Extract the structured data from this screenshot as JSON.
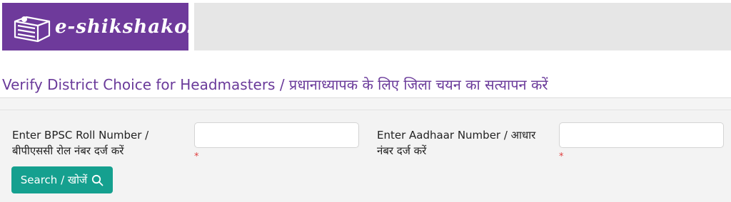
{
  "brand": {
    "logo_text": "e-shikshakosh",
    "logo_icon": "book-stack-icon",
    "logo_color": "#6e3a9b"
  },
  "page": {
    "title": "Verify District Choice for Headmasters / प्रधानाध्यापक के लिए जिला चयन का सत्यापन करें",
    "title_color": "#6a3a9a"
  },
  "form": {
    "roll_number": {
      "label_en": "Enter BPSC Roll Number /",
      "label_hi": "बीपीएससी रोल नंबर दर्ज करें",
      "value": "",
      "required_mark": "*"
    },
    "aadhaar_number": {
      "label_en": "Enter Aadhaar Number / आधार",
      "label_hi": "नंबर दर्ज करें",
      "value": "",
      "required_mark": "*"
    },
    "search_button": {
      "label": "Search / खोजें",
      "icon": "search-icon",
      "color": "#15a08f"
    }
  }
}
